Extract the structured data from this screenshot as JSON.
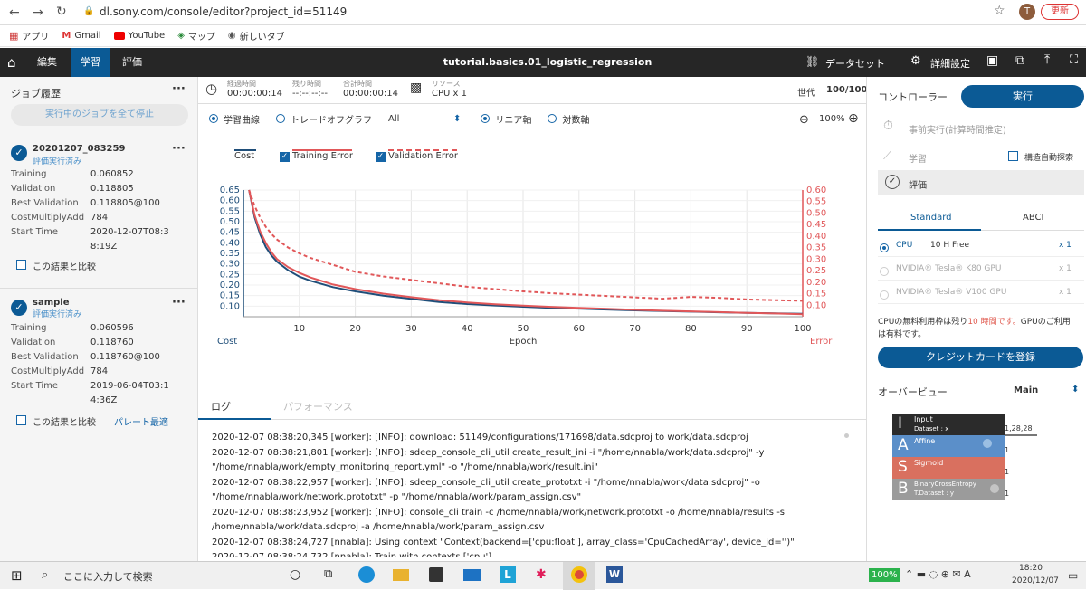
{
  "browser": {
    "url": "dl.sony.com/console/editor?project_id=51149",
    "avatar": "T",
    "update_label": "更新"
  },
  "bookmarks": [
    {
      "label": "アプリ",
      "icon": "apps-grid-icon"
    },
    {
      "label": "Gmail",
      "icon": "gmail-icon"
    },
    {
      "label": "YouTube",
      "icon": "youtube-icon"
    },
    {
      "label": "マップ",
      "icon": "maps-icon"
    },
    {
      "label": "新しいタブ",
      "icon": "globe-icon"
    }
  ],
  "appbar": {
    "tabs": [
      {
        "label": "編集"
      },
      {
        "label": "学習"
      },
      {
        "label": "評価"
      }
    ],
    "project_title": "tutorial.basics.01_logistic_regression",
    "dataset_label": "データセット",
    "settings_label": "詳細設定"
  },
  "job_history": {
    "title": "ジョブ履歴",
    "stop_all": "実行中のジョブを全て停止",
    "jobs": [
      {
        "name": "20201207_083259",
        "status": "評価実行済み",
        "metrics": [
          {
            "k": "Training",
            "v": "0.060852"
          },
          {
            "k": "Validation",
            "v": "0.118805"
          },
          {
            "k": "Best Validation",
            "v": "0.118805@100"
          },
          {
            "k": "CostMultiplyAdd",
            "v": "784"
          },
          {
            "k": "Start Time",
            "v": "2020-12-07T08:3"
          },
          {
            "k": "",
            "v": "8:19Z"
          }
        ],
        "compare": "この結果と比較"
      },
      {
        "name": "sample",
        "status": "評価実行済み",
        "metrics": [
          {
            "k": "Training",
            "v": "0.060596"
          },
          {
            "k": "Validation",
            "v": "0.118760"
          },
          {
            "k": "Best Validation",
            "v": "0.118760@100"
          },
          {
            "k": "CostMultiplyAdd",
            "v": "784"
          },
          {
            "k": "Start Time",
            "v": "2019-06-04T03:1"
          },
          {
            "k": "",
            "v": "4:36Z"
          }
        ],
        "compare": "この結果と比較",
        "pareto": "パレート最適"
      }
    ]
  },
  "stats": {
    "elapsed_label": "経過時間",
    "elapsed": "00:00:00:14",
    "remaining_label": "残り時間",
    "remaining": "--:--:--:--",
    "total_label": "合計時間",
    "total": "00:00:00:14",
    "resource_label": "リソース",
    "resource": "CPU x 1",
    "generation_label": "世代",
    "generation": "100/100"
  },
  "chart_controls": {
    "learning_curve": "学習曲線",
    "tradeoff": "トレードオフグラフ",
    "filter": "All",
    "linear": "リニア軸",
    "log": "対数軸",
    "zoom": "100%"
  },
  "legend": {
    "cost": "Cost",
    "train": "Training Error",
    "valid": "Validation Error"
  },
  "chart_data": {
    "type": "line",
    "xlabel": "Epoch",
    "ylabel_left": "Cost",
    "ylabel_right": "Error",
    "x_ticks": [
      "10",
      "20",
      "30",
      "40",
      "50",
      "60",
      "70",
      "80",
      "90",
      "100"
    ],
    "y_left_ticks": [
      "0.65",
      "0.60",
      "0.55",
      "0.50",
      "0.45",
      "0.40",
      "0.35",
      "0.30",
      "0.25",
      "0.20",
      "0.15",
      "0.10"
    ],
    "y_right_ticks": [
      "0.60",
      "0.55",
      "0.50",
      "0.45",
      "0.40",
      "0.35",
      "0.30",
      "0.25",
      "0.20",
      "0.15",
      "0.10"
    ],
    "xlim": [
      0,
      100
    ],
    "ylim_left": [
      0.05,
      0.65
    ],
    "ylim_right": [
      0.05,
      0.6
    ],
    "series": [
      {
        "name": "Cost",
        "axis": "left",
        "color": "#1f4e79",
        "style": "solid",
        "x": [
          1,
          2,
          3,
          4,
          5,
          6,
          8,
          10,
          12,
          14,
          16,
          18,
          20,
          25,
          30,
          35,
          40,
          45,
          50,
          55,
          60,
          65,
          70,
          75,
          80,
          85,
          90,
          95,
          100
        ],
        "y": [
          0.65,
          0.52,
          0.44,
          0.38,
          0.34,
          0.31,
          0.27,
          0.24,
          0.22,
          0.205,
          0.19,
          0.18,
          0.17,
          0.15,
          0.135,
          0.12,
          0.11,
          0.103,
          0.097,
          0.092,
          0.088,
          0.084,
          0.08,
          0.077,
          0.074,
          0.071,
          0.068,
          0.066,
          0.064
        ]
      },
      {
        "name": "Training Error",
        "axis": "right",
        "color": "#e15759",
        "style": "solid",
        "x": [
          1,
          2,
          3,
          4,
          5,
          6,
          8,
          10,
          12,
          14,
          16,
          18,
          20,
          25,
          30,
          35,
          40,
          45,
          50,
          55,
          60,
          65,
          70,
          75,
          80,
          85,
          90,
          95,
          100
        ],
        "y": [
          0.6,
          0.49,
          0.42,
          0.37,
          0.33,
          0.3,
          0.265,
          0.24,
          0.22,
          0.205,
          0.19,
          0.18,
          0.17,
          0.15,
          0.135,
          0.122,
          0.112,
          0.104,
          0.098,
          0.093,
          0.088,
          0.084,
          0.08,
          0.076,
          0.073,
          0.07,
          0.067,
          0.064,
          0.061
        ]
      },
      {
        "name": "Validation Error",
        "axis": "right",
        "color": "#e15759",
        "style": "dashed",
        "x": [
          1,
          2,
          3,
          4,
          5,
          6,
          8,
          10,
          12,
          14,
          16,
          18,
          20,
          25,
          30,
          35,
          40,
          45,
          50,
          55,
          60,
          65,
          70,
          75,
          80,
          85,
          90,
          95,
          100
        ],
        "y": [
          0.6,
          0.53,
          0.48,
          0.44,
          0.41,
          0.385,
          0.35,
          0.325,
          0.305,
          0.29,
          0.275,
          0.26,
          0.245,
          0.225,
          0.21,
          0.195,
          0.18,
          0.17,
          0.16,
          0.152,
          0.146,
          0.14,
          0.134,
          0.128,
          0.136,
          0.132,
          0.125,
          0.122,
          0.119
        ]
      }
    ]
  },
  "log": {
    "tab_log": "ログ",
    "tab_perf": "パフォーマンス",
    "lines": [
      "2020-12-07 08:38:20,345 [worker]: [INFO]: download: 51149/configurations/171698/data.sdcproj to work/data.sdcproj",
      "2020-12-07 08:38:21,801 [worker]: [INFO]: sdeep_console_cli_util create_result_ini -i \"/home/nnabla/work/data.sdcproj\" -y",
      "\"/home/nnabla/work/empty_monitoring_report.yml\" -o \"/home/nnabla/work/result.ini\"",
      "2020-12-07 08:38:22,957 [worker]: [INFO]: sdeep_console_cli_util create_prototxt -i \"/home/nnabla/work/data.sdcproj\" -o",
      "\"/home/nnabla/work/network.prototxt\" -p \"/home/nnabla/work/param_assign.csv\"",
      "2020-12-07 08:38:23,952 [worker]: [INFO]: console_cli train -c /home/nnabla/work/network.prototxt -o /home/nnabla/results -s",
      "/home/nnabla/work/data.sdcproj -a /home/nnabla/work/param_assign.csv",
      "2020-12-07 08:38:24,727 [nnabla]: Using context \"Context(backend=['cpu:float'], array_class='CpuCachedArray', device_id='')\"",
      "2020-12-07 08:38:24,732 [nnabla]: Train with contexts ['cpu']"
    ]
  },
  "controller": {
    "title": "コントローラー",
    "run": "実行",
    "pre_run": "事前実行(計算時間推定)",
    "train": "学習",
    "auto_search": "構造自動探索",
    "evaluate": "評価",
    "tab_standard": "Standard",
    "tab_abci": "ABCI",
    "resources": [
      {
        "name": "CPU",
        "spec": "10 H Free",
        "count": "x 1",
        "selected": true
      },
      {
        "name": "NVIDIA® Tesla® K80 GPU",
        "spec": "",
        "count": "x 1",
        "selected": false
      },
      {
        "name": "NVIDIA® Tesla® V100 GPU",
        "spec": "",
        "count": "x 1",
        "selected": false
      }
    ],
    "free_note_a": "CPUの無料利用枠は残り",
    "free_note_hours": "10 時間です。",
    "free_note_b": "GPUのご利用",
    "free_note_c": "は有料です。",
    "register_card": "クレジットカードを登録",
    "overview": "オーバービュー",
    "overview_select": "Main"
  },
  "network": [
    {
      "letter": "I",
      "name": "Input",
      "sub": "Dataset : x",
      "color": "#2b2b2b",
      "size": "1,28,28"
    },
    {
      "letter": "A",
      "name": "Affine",
      "sub": "",
      "color": "#5b8fc9",
      "size": "1"
    },
    {
      "letter": "S",
      "name": "Sigmoid",
      "sub": "",
      "color": "#d9705f",
      "size": "1"
    },
    {
      "letter": "B",
      "name": "BinaryCrossEntropy",
      "sub": "T.Dataset : y",
      "color": "#9b9b9b",
      "size": "1"
    }
  ],
  "taskbar": {
    "search": "ここに入力して検索",
    "battery": "100%",
    "time": "18:20",
    "date": "2020/12/07"
  }
}
